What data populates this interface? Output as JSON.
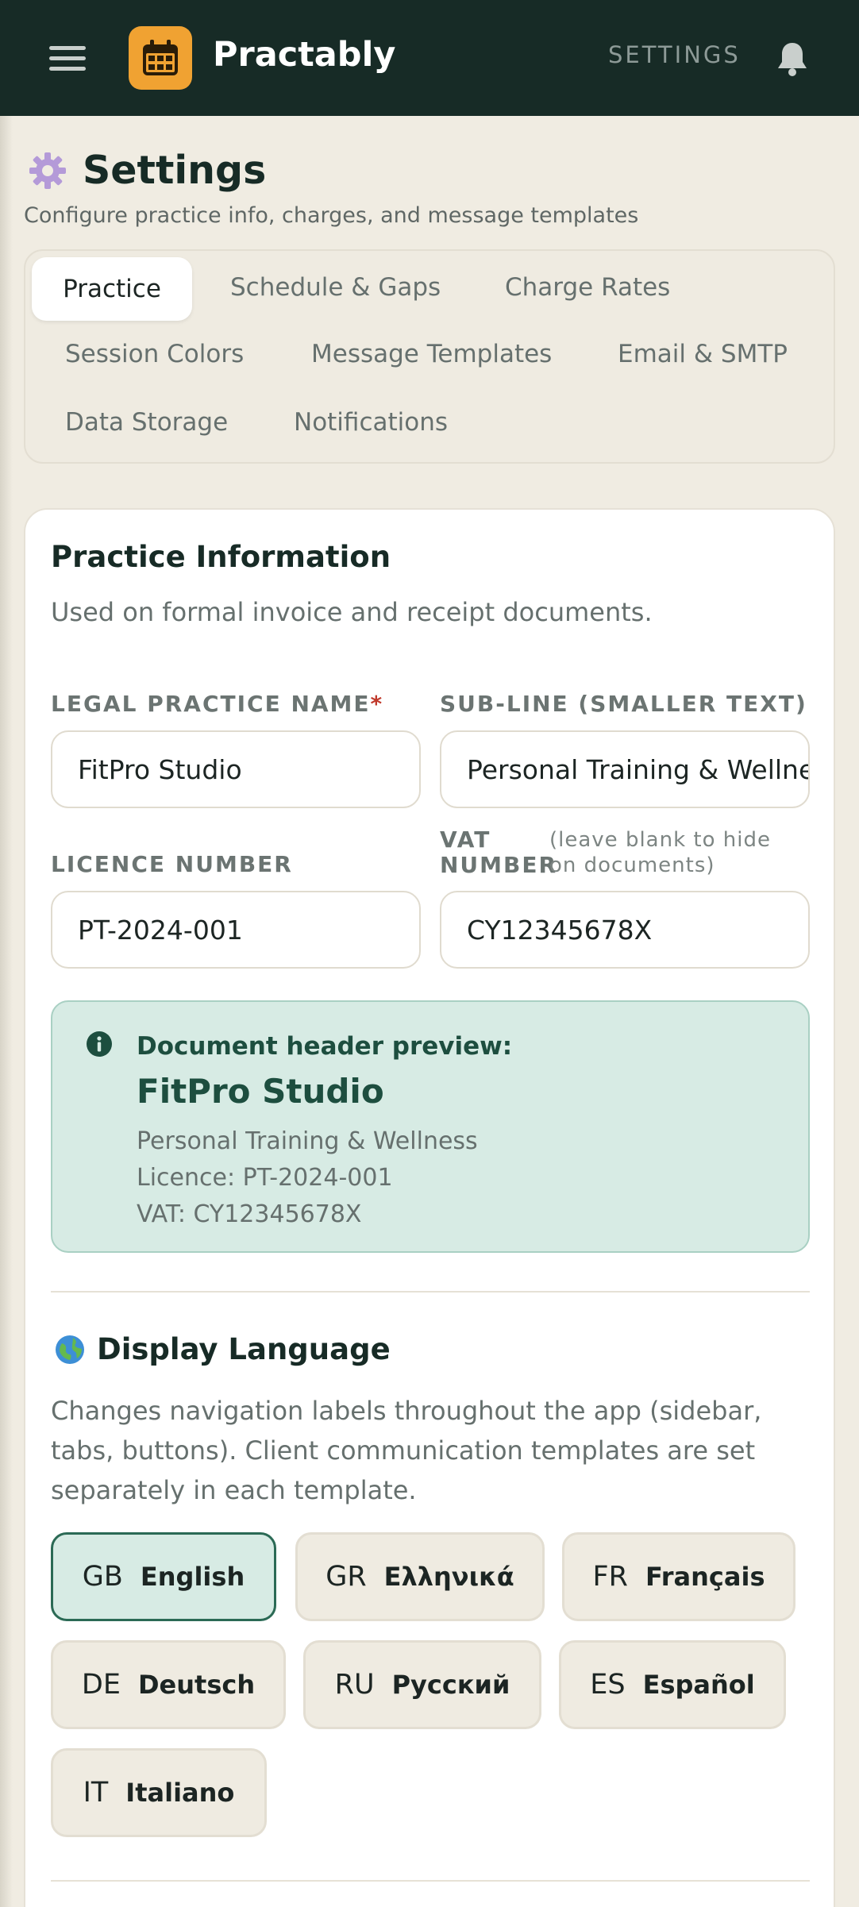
{
  "topbar": {
    "brand": "Practably",
    "nav_settings": "SETTINGS"
  },
  "page": {
    "title": "Settings",
    "subtitle": "Configure practice info, charges, and message templates"
  },
  "tabs": [
    {
      "label": "Practice",
      "active": true
    },
    {
      "label": "Schedule & Gaps"
    },
    {
      "label": "Charge Rates"
    },
    {
      "label": "Session Colors"
    },
    {
      "label": "Message Templates"
    },
    {
      "label": "Email & SMTP"
    },
    {
      "label": "Data Storage"
    },
    {
      "label": "Notifications"
    }
  ],
  "practice_info": {
    "title": "Practice Information",
    "description": "Used on formal invoice and receipt documents.",
    "fields": {
      "legal_name": {
        "label": "LEGAL PRACTICE NAME",
        "required_mark": "*",
        "value": "FitPro Studio"
      },
      "sub_line": {
        "label": "SUB-LINE (SMALLER TEXT)",
        "value": "Personal Training & Wellness"
      },
      "licence": {
        "label": "LICENCE NUMBER",
        "value": "PT-2024-001"
      },
      "vat": {
        "label_line1": "VAT",
        "label_line2": "NUMBER",
        "hint_line1": "(leave blank to hide",
        "hint_line2": "on documents)",
        "value": "CY12345678X"
      }
    },
    "preview": {
      "label": "Document header preview:",
      "name": "FitPro Studio",
      "sub_line": "Personal Training & Wellness",
      "licence": "Licence: PT-2024-001",
      "vat": "VAT: CY12345678X"
    }
  },
  "language": {
    "title": "Display Language",
    "description": "Changes navigation labels throughout the app (sidebar, tabs, buttons). Client communication templates are set separately in each template.",
    "options": [
      {
        "code": "GB",
        "name": "English",
        "selected": true
      },
      {
        "code": "GR",
        "name": "Ελληνικά"
      },
      {
        "code": "FR",
        "name": "Français"
      },
      {
        "code": "DE",
        "name": "Deutsch"
      },
      {
        "code": "RU",
        "name": "Русский"
      },
      {
        "code": "ES",
        "name": "Español"
      },
      {
        "code": "IT",
        "name": "Italiano"
      }
    ]
  },
  "colors": {
    "topbar": "#172b26",
    "accent_orange": "#f0a232",
    "accent_green": "#2b6a55",
    "preview_bg": "#d7ebe4"
  },
  "icons": {
    "menu": "hamburger-icon",
    "logo": "calendar-icon",
    "bell": "bell-icon",
    "gear": "gear-icon",
    "info": "info-icon",
    "globe": "globe-icon"
  }
}
